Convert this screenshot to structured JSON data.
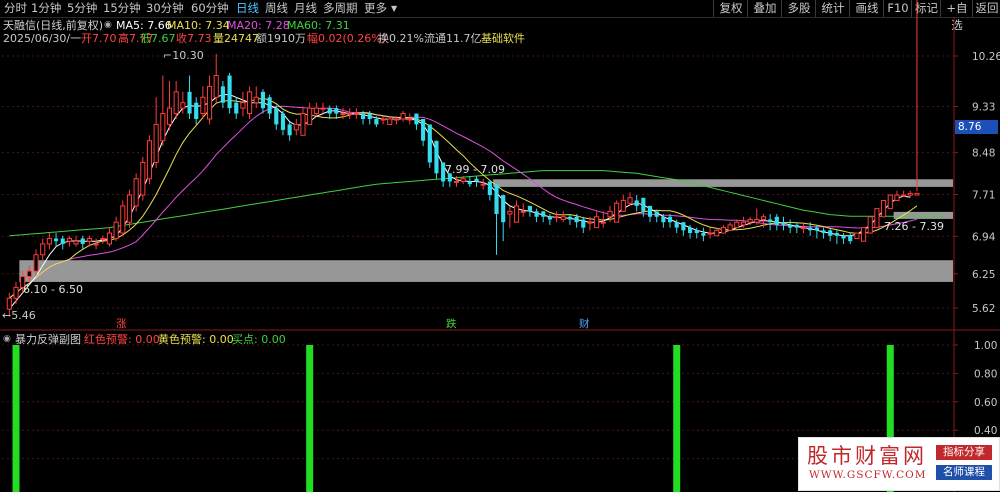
{
  "toolbar": {
    "periods": [
      "分时",
      "1分钟",
      "5分钟",
      "15分钟",
      "30分钟",
      "60分钟",
      "日线",
      "周线",
      "月线",
      "多周期",
      "更多"
    ],
    "active_period": "日线",
    "right_buttons": [
      "复权",
      "叠加",
      "多股",
      "统计",
      "画线",
      "F10",
      "标记",
      "+自选",
      "返回"
    ]
  },
  "chart_header": {
    "title": "天融信(日线,前复权)",
    "ma5": "MA5: 7.66",
    "ma10": "MA10: 7.34",
    "ma20": "MA20: 7.28",
    "ma60": "MA60: 7.31",
    "date": "2025/06/30/一",
    "open": "开7.70",
    "high": "高7.77",
    "low": "低7.67",
    "close": "收7.73",
    "volume": "量24747",
    "amount": "额1910万",
    "change": "幅0.02(0.26%)",
    "turnover": "换0.21%",
    "float_cap": "流通11.7亿",
    "concept": "基础软件"
  },
  "price_axis": {
    "ticks": [
      "10.26",
      "9.33",
      "8.48",
      "7.71",
      "6.94",
      "6.25",
      "5.62"
    ],
    "current_price": "8.76"
  },
  "indicator_axis": {
    "ticks": [
      "1.00",
      "0.80",
      "0.60",
      "0.40",
      "0.20"
    ]
  },
  "annotations": {
    "max_price": "10.30",
    "min_price": "5.46",
    "zone_low": "6.10 - 6.50",
    "zone_mid": "7.99 - 7.09",
    "zone_right": "7.26 - 7.39",
    "marker_up": "涨",
    "marker_down": "跌",
    "marker_finance": "财"
  },
  "indicator": {
    "title": "暴力反弹副图",
    "red_alert": "红色预警: 0.00",
    "yellow_alert": "黄色预警: 0.00",
    "buy_point": "买点: 0.00"
  },
  "watermark": {
    "title": "股市财富网",
    "url": "WWW.GSCFW.COM",
    "tag1": "指标分享",
    "tag2": "名师课程"
  },
  "colors": {
    "up": "#ff3b3b",
    "down": "#33ddee",
    "ma5": "#ffffff",
    "ma10": "#e8e050",
    "ma20": "#e050e0",
    "ma60": "#40d040",
    "signal": "#22dd22",
    "zone": "#b8b8b8"
  },
  "chart_data": {
    "type": "candlestick",
    "x": [
      1,
      2,
      3,
      4,
      5,
      6,
      7,
      8,
      9,
      10,
      11,
      12,
      13,
      14,
      15,
      16,
      17,
      18,
      19,
      20,
      21,
      22,
      23,
      24,
      25,
      26,
      27,
      28,
      29,
      30,
      31,
      32,
      33,
      34,
      35,
      36,
      37,
      38,
      39,
      40,
      41,
      42,
      43,
      44,
      45,
      46,
      47,
      48,
      49,
      50,
      51,
      52,
      53,
      54,
      55,
      56,
      57,
      58,
      59,
      60,
      61,
      62,
      63,
      64,
      65,
      66,
      67,
      68,
      69,
      70,
      71,
      72,
      73,
      74,
      75,
      76,
      77,
      78,
      79,
      80,
      81,
      82,
      83,
      84,
      85,
      86,
      87,
      88,
      89,
      90,
      91,
      92,
      93,
      94,
      95,
      96,
      97,
      98,
      99,
      100,
      101,
      102,
      103,
      104,
      105,
      106,
      107,
      108,
      109,
      110,
      111,
      112,
      113,
      114,
      115,
      116,
      117,
      118,
      119,
      120,
      121,
      122,
      123,
      124,
      125,
      126,
      127,
      128,
      129,
      130,
      131,
      132,
      133,
      134,
      135,
      136,
      137,
      138,
      139,
      140,
      141
    ],
    "open": [
      5.6,
      5.8,
      6.0,
      6.2,
      6.3,
      6.6,
      6.8,
      6.9,
      6.9,
      6.85,
      6.8,
      6.9,
      6.85,
      6.8,
      6.9,
      6.8,
      6.9,
      7.0,
      7.2,
      7.5,
      7.7,
      8.0,
      8.3,
      8.7,
      9.0,
      9.2,
      9.3,
      9.6,
      9.4,
      9.2,
      9.1,
      9.5,
      9.7,
      9.9,
      9.4,
      9.3,
      9.2,
      9.4,
      9.6,
      9.5,
      9.3,
      9.2,
      9.0,
      8.9,
      8.8,
      9.0,
      9.2,
      9.3,
      9.3,
      9.3,
      9.2,
      9.2,
      9.2,
      9.2,
      9.2,
      9.1,
      9.1,
      9.0,
      9.1,
      9.1,
      9.1,
      9.2,
      9.1,
      9.0,
      8.7,
      8.3,
      8.1,
      7.95,
      7.95,
      7.95,
      8.0,
      7.9,
      7.95,
      7.9,
      7.7,
      7.35,
      7.2,
      7.4,
      7.5,
      7.4,
      7.4,
      7.3,
      7.3,
      7.25,
      7.3,
      7.3,
      7.25,
      7.2,
      7.1,
      7.2,
      7.3,
      7.2,
      7.4,
      7.55,
      7.6,
      7.65,
      7.5,
      7.4,
      7.3,
      7.3,
      7.2,
      7.2,
      7.1,
      7.05,
      7.0,
      7.0,
      6.95,
      7.0,
      7.05,
      7.1,
      7.15,
      7.2,
      7.2,
      7.25,
      7.25,
      7.3,
      7.2,
      7.15,
      7.15,
      7.1,
      7.1,
      7.1,
      7.05,
      7.05,
      7.0,
      6.95,
      6.95,
      6.9,
      6.85,
      7.0,
      7.1,
      7.3,
      7.45,
      7.6,
      7.7,
      7.7,
      7.7,
      7.7
    ],
    "close": [
      5.8,
      6.0,
      6.2,
      6.3,
      6.6,
      6.8,
      6.9,
      6.85,
      6.8,
      6.9,
      6.85,
      6.8,
      6.9,
      6.8,
      6.9,
      7.0,
      7.2,
      7.5,
      7.7,
      8.0,
      8.3,
      8.7,
      9.0,
      9.2,
      9.3,
      9.6,
      9.4,
      9.2,
      9.1,
      9.5,
      9.7,
      9.9,
      9.4,
      9.3,
      9.2,
      9.4,
      9.6,
      9.5,
      9.3,
      9.2,
      9.0,
      8.9,
      8.8,
      9.0,
      9.2,
      9.3,
      9.3,
      9.3,
      9.2,
      9.2,
      9.2,
      9.2,
      9.2,
      9.1,
      9.1,
      9.0,
      9.1,
      9.1,
      9.1,
      9.2,
      9.1,
      9.0,
      8.7,
      8.3,
      8.1,
      7.95,
      7.95,
      7.95,
      8.0,
      7.9,
      7.95,
      7.9,
      7.7,
      7.35,
      7.2,
      7.4,
      7.5,
      7.4,
      7.4,
      7.3,
      7.3,
      7.25,
      7.3,
      7.3,
      7.25,
      7.2,
      7.1,
      7.2,
      7.3,
      7.2,
      7.4,
      7.55,
      7.6,
      7.65,
      7.5,
      7.4,
      7.3,
      7.3,
      7.2,
      7.2,
      7.1,
      7.05,
      7.0,
      7.0,
      6.95,
      7.0,
      7.05,
      7.1,
      7.15,
      7.2,
      7.2,
      7.25,
      7.25,
      7.3,
      7.2,
      7.15,
      7.15,
      7.1,
      7.1,
      7.1,
      7.05,
      7.05,
      7.0,
      6.95,
      6.95,
      6.9,
      6.85,
      7.0,
      7.1,
      7.3,
      7.45,
      7.6,
      7.7,
      7.7,
      7.7,
      7.73,
      7.73
    ],
    "high": [
      5.9,
      6.1,
      6.3,
      6.4,
      6.7,
      6.9,
      7.0,
      7.0,
      6.95,
      6.95,
      6.95,
      6.95,
      6.95,
      6.9,
      6.95,
      7.1,
      7.3,
      7.6,
      7.8,
      8.1,
      8.4,
      8.8,
      9.5,
      9.9,
      9.8,
      9.8,
      9.6,
      9.9,
      9.5,
      9.7,
      9.9,
      10.3,
      9.8,
      9.95,
      9.5,
      9.6,
      9.7,
      9.7,
      9.65,
      9.55,
      9.35,
      9.25,
      9.05,
      9.1,
      9.3,
      9.4,
      9.4,
      9.4,
      9.35,
      9.35,
      9.3,
      9.3,
      9.3,
      9.25,
      9.25,
      9.15,
      9.15,
      9.15,
      9.15,
      9.25,
      9.2,
      9.2,
      9.0,
      8.7,
      8.35,
      8.1,
      8.05,
      8.05,
      8.05,
      8.05,
      8.05,
      8.0,
      7.95,
      7.7,
      7.45,
      7.5,
      7.6,
      7.55,
      7.5,
      7.45,
      7.4,
      7.35,
      7.4,
      7.4,
      7.35,
      7.35,
      7.3,
      7.3,
      7.4,
      7.4,
      7.5,
      7.6,
      7.7,
      7.75,
      7.7,
      7.6,
      7.5,
      7.4,
      7.35,
      7.35,
      7.25,
      7.2,
      7.15,
      7.1,
      7.1,
      7.1,
      7.1,
      7.15,
      7.2,
      7.25,
      7.3,
      7.3,
      7.45,
      7.35,
      7.35,
      7.35,
      7.3,
      7.25,
      7.2,
      7.2,
      7.2,
      7.15,
      7.1,
      7.1,
      7.05,
      7.0,
      7.0,
      6.95,
      7.05,
      7.15,
      7.35,
      7.5,
      7.65,
      7.78,
      7.78,
      7.78,
      7.77
    ],
    "low": [
      5.46,
      5.7,
      5.9,
      6.1,
      6.2,
      6.5,
      6.7,
      6.75,
      6.7,
      6.75,
      6.75,
      6.7,
      6.75,
      6.7,
      6.8,
      6.75,
      6.85,
      6.95,
      7.1,
      7.4,
      7.6,
      7.9,
      8.2,
      8.6,
      8.9,
      9.1,
      9.2,
      9.1,
      9.0,
      9.1,
      9.0,
      9.4,
      9.3,
      9.2,
      9.1,
      9.15,
      9.1,
      9.3,
      9.2,
      9.1,
      8.9,
      8.8,
      8.7,
      8.8,
      8.8,
      9.0,
      9.15,
      9.2,
      9.1,
      9.1,
      9.1,
      9.1,
      9.1,
      9.0,
      9.0,
      8.95,
      9.0,
      9.0,
      9.0,
      9.05,
      9.0,
      8.9,
      8.6,
      8.2,
      8.0,
      7.85,
      7.85,
      7.85,
      7.9,
      7.85,
      7.85,
      7.8,
      7.6,
      6.6,
      6.85,
      7.1,
      7.3,
      7.3,
      7.3,
      7.2,
      7.2,
      7.15,
      7.2,
      7.2,
      7.15,
      7.1,
      7.0,
      7.05,
      7.1,
      7.1,
      7.2,
      7.4,
      7.5,
      7.5,
      7.4,
      7.3,
      7.2,
      7.2,
      7.1,
      7.1,
      7.0,
      6.95,
      6.9,
      6.9,
      6.85,
      6.9,
      6.95,
      7.0,
      7.05,
      7.1,
      7.1,
      7.15,
      7.15,
      7.1,
      7.05,
      7.05,
      7.05,
      7.0,
      7.0,
      7.0,
      6.95,
      6.9,
      6.9,
      6.85,
      6.8,
      6.8,
      6.8,
      6.9,
      7.0,
      7.2,
      7.35,
      7.5,
      7.6,
      7.6,
      7.67,
      7.67
    ],
    "ma5": [
      5.6,
      5.75,
      5.9,
      6.05,
      6.2,
      6.4,
      6.6,
      6.75,
      6.82,
      6.85,
      6.86,
      6.85,
      6.85,
      6.85,
      6.87,
      6.9,
      6.95,
      7.1,
      7.3,
      7.55,
      7.8,
      8.1,
      8.4,
      8.7,
      8.95,
      9.15,
      9.3,
      9.35,
      9.33,
      9.35,
      9.4,
      9.5,
      9.55,
      9.55,
      9.5,
      9.45,
      9.4,
      9.4,
      9.4,
      9.35,
      9.3,
      9.2,
      9.05,
      8.98,
      9.0,
      9.05,
      9.15,
      9.2,
      9.25,
      9.25,
      9.22,
      9.2,
      9.2,
      9.18,
      9.15,
      9.12,
      9.1,
      9.1,
      9.1,
      9.1,
      9.1,
      9.08,
      9.0,
      8.8,
      8.5,
      8.25,
      8.05,
      7.98,
      7.96,
      7.95,
      7.95,
      7.93,
      7.88,
      7.75,
      7.6,
      7.5,
      7.45,
      7.42,
      7.4,
      7.37,
      7.33,
      7.3,
      7.29,
      7.28,
      7.27,
      7.25,
      7.22,
      7.2,
      7.2,
      7.22,
      7.28,
      7.35,
      7.45,
      7.52,
      7.55,
      7.52,
      7.45,
      7.38,
      7.3,
      7.25,
      7.2,
      7.15,
      7.1,
      7.05,
      7.02,
      7.0,
      7.0,
      7.02,
      7.05,
      7.1,
      7.14,
      7.18,
      7.22,
      7.23,
      7.22,
      7.2,
      7.18,
      7.15,
      7.12,
      7.1,
      7.08,
      7.05,
      7.02,
      7.0,
      6.97,
      6.95,
      6.95,
      6.98,
      7.05,
      7.15,
      7.28,
      7.42,
      7.55,
      7.64,
      7.68,
      7.66
    ],
    "ma60": [
      6.95,
      6.96,
      6.97,
      6.98,
      6.99,
      7.0,
      7.01,
      7.02,
      7.03,
      7.04,
      7.05,
      7.06,
      7.07,
      7.08,
      7.09,
      7.1,
      7.12,
      7.14,
      7.16,
      7.18,
      7.2,
      7.22,
      7.24,
      7.26,
      7.28,
      7.3,
      7.32,
      7.34,
      7.36,
      7.38,
      7.4,
      7.42,
      7.44,
      7.46,
      7.48,
      7.5,
      7.52,
      7.54,
      7.56,
      7.58,
      7.6,
      7.62,
      7.64,
      7.66,
      7.68,
      7.7,
      7.72,
      7.74,
      7.76,
      7.78,
      7.8,
      7.82,
      7.84,
      7.86,
      7.88,
      7.9,
      7.91,
      7.92,
      7.93,
      7.94,
      7.95,
      7.96,
      7.97,
      7.98,
      7.99,
      8.0,
      8.01,
      8.02,
      8.03,
      8.04,
      8.05,
      8.06,
      8.07,
      8.08,
      8.09,
      8.1,
      8.11,
      8.12,
      8.13,
      8.14,
      8.15,
      8.15,
      8.15,
      8.15,
      8.15,
      8.15,
      8.15,
      8.15,
      8.15,
      8.15,
      8.14,
      8.13,
      8.12,
      8.11,
      8.1,
      8.08,
      8.06,
      8.04,
      8.02,
      8.0,
      7.98,
      7.96,
      7.93,
      7.9,
      7.87,
      7.84,
      7.81,
      7.78,
      7.75,
      7.72,
      7.69,
      7.66,
      7.63,
      7.6,
      7.57,
      7.54,
      7.51,
      7.48,
      7.45,
      7.42,
      7.4,
      7.38,
      7.36,
      7.34,
      7.33,
      7.32,
      7.31,
      7.31,
      7.31,
      7.31,
      7.31,
      7.31,
      7.31,
      7.31,
      7.31,
      7.31,
      7.31,
      7.31,
      7.31,
      7.31,
      7.31
    ],
    "signal_days": [
      2,
      46,
      101,
      133
    ],
    "signal_value": 1.0,
    "zones": [
      {
        "label": "6.10 - 6.50",
        "low": 6.1,
        "high": 6.5,
        "start": 3
      },
      {
        "label": "7.99 - 7.09",
        "low": 7.85,
        "high": 7.99,
        "start": 74
      },
      {
        "label": "7.26 - 7.39",
        "low": 7.26,
        "high": 7.39,
        "start": 134
      }
    ],
    "ylim": [
      5.4,
      10.6
    ]
  }
}
